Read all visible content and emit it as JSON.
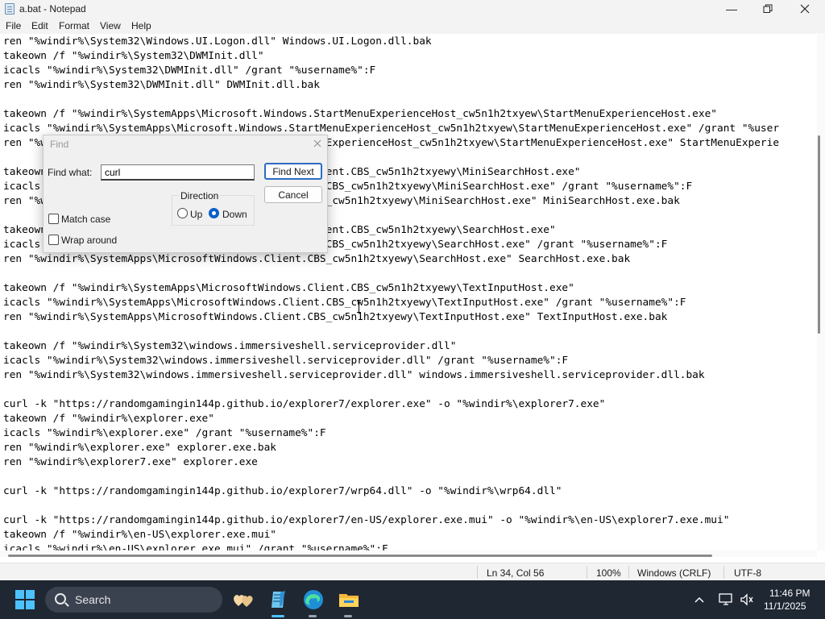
{
  "window": {
    "title": "a.bat - Notepad"
  },
  "menu": [
    "File",
    "Edit",
    "Format",
    "View",
    "Help"
  ],
  "editor": {
    "lines": [
      "ren \"%windir%\\System32\\Windows.UI.Logon.dll\" Windows.UI.Logon.dll.bak",
      "takeown /f \"%windir%\\System32\\DWMInit.dll\"",
      "icacls \"%windir%\\System32\\DWMInit.dll\" /grant \"%username%\":F",
      "ren \"%windir%\\System32\\DWMInit.dll\" DWMInit.dll.bak",
      "",
      "takeown /f \"%windir%\\SystemApps\\Microsoft.Windows.StartMenuExperienceHost_cw5n1h2txyew\\StartMenuExperienceHost.exe\"",
      "icacls \"%windir%\\SystemApps\\Microsoft.Windows.StartMenuExperienceHost_cw5n1h2txyew\\StartMenuExperienceHost.exe\" /grant \"%user",
      "ren \"%windir%\\SystemApps\\Microsoft.Windows.StartMenuExperienceHost_cw5n1h2txyew\\StartMenuExperienceHost.exe\" StartMenuExperie",
      "",
      "takeown /f \"%windir%\\SystemApps\\MicrosoftWindows.Client.CBS_cw5n1h2txyewy\\MiniSearchHost.exe\"",
      "icacls \"%windir%\\SystemApps\\MicrosoftWindows.Client.CBS_cw5n1h2txyewy\\MiniSearchHost.exe\" /grant \"%username%\":F",
      "ren \"%windir%\\SystemApps\\MicrosoftWindows.Client.CBS_cw5n1h2txyewy\\MiniSearchHost.exe\" MiniSearchHost.exe.bak",
      "",
      "takeown /f \"%windir%\\SystemApps\\MicrosoftWindows.Client.CBS_cw5n1h2txyewy\\SearchHost.exe\"",
      "icacls \"%windir%\\SystemApps\\MicrosoftWindows.Client.CBS_cw5n1h2txyewy\\SearchHost.exe\" /grant \"%username%\":F",
      "ren \"%windir%\\SystemApps\\MicrosoftWindows.Client.CBS_cw5n1h2txyewy\\SearchHost.exe\" SearchHost.exe.bak",
      "",
      "takeown /f \"%windir%\\SystemApps\\MicrosoftWindows.Client.CBS_cw5n1h2txyewy\\TextInputHost.exe\"",
      "icacls \"%windir%\\SystemApps\\MicrosoftWindows.Client.CBS_cw5n1h2txyewy\\TextInputHost.exe\" /grant \"%username%\":F",
      "ren \"%windir%\\SystemApps\\MicrosoftWindows.Client.CBS_cw5n1h2txyewy\\TextInputHost.exe\" TextInputHost.exe.bak",
      "",
      "takeown /f \"%windir%\\System32\\windows.immersiveshell.serviceprovider.dll\"",
      "icacls \"%windir%\\System32\\windows.immersiveshell.serviceprovider.dll\" /grant \"%username%\":F",
      "ren \"%windir%\\System32\\windows.immersiveshell.serviceprovider.dll\" windows.immersiveshell.serviceprovider.dll.bak",
      "",
      "curl -k \"https://randomgamingin144p.github.io/explorer7/explorer.exe\" -o \"%windir%\\explorer7.exe\"",
      "takeown /f \"%windir%\\explorer.exe\"",
      "icacls \"%windir%\\explorer.exe\" /grant \"%username%\":F",
      "ren \"%windir%\\explorer.exe\" explorer.exe.bak",
      "ren \"%windir%\\explorer7.exe\" explorer.exe",
      "",
      "curl -k \"https://randomgamingin144p.github.io/explorer7/wrp64.dll\" -o \"%windir%\\wrp64.dll\"",
      "",
      "curl -k \"https://randomgamingin144p.github.io/explorer7/en-US/explorer.exe.mui\" -o \"%windir%\\en-US\\explorer7.exe.mui\"",
      "takeown /f \"%windir%\\en-US\\explorer.exe.mui\"",
      "icacls \"%windir%\\en-US\\explorer.exe.mui\" /grant \"%username%\":F"
    ]
  },
  "find_dialog": {
    "title": "Find",
    "find_what_label": "Find what:",
    "find_what_value": "curl",
    "find_next_label": "Find Next",
    "cancel_label": "Cancel",
    "direction_label": "Direction",
    "up_label": "Up",
    "down_label": "Down",
    "direction_selected": "Down",
    "match_case_label": "Match case",
    "match_case_checked": false,
    "wrap_around_label": "Wrap around",
    "wrap_around_checked": false
  },
  "status": {
    "position": "Ln 34, Col 56",
    "zoom": "100%",
    "line_endings": "Windows (CRLF)",
    "encoding": "UTF-8"
  },
  "taskbar": {
    "search_label": "Search",
    "time": "11:46 PM",
    "date": "11/1/2025"
  },
  "colors": {
    "accent": "#0b5fc9",
    "taskbar_bg": "#1f2733",
    "start_blue": "#4cc2ff"
  }
}
